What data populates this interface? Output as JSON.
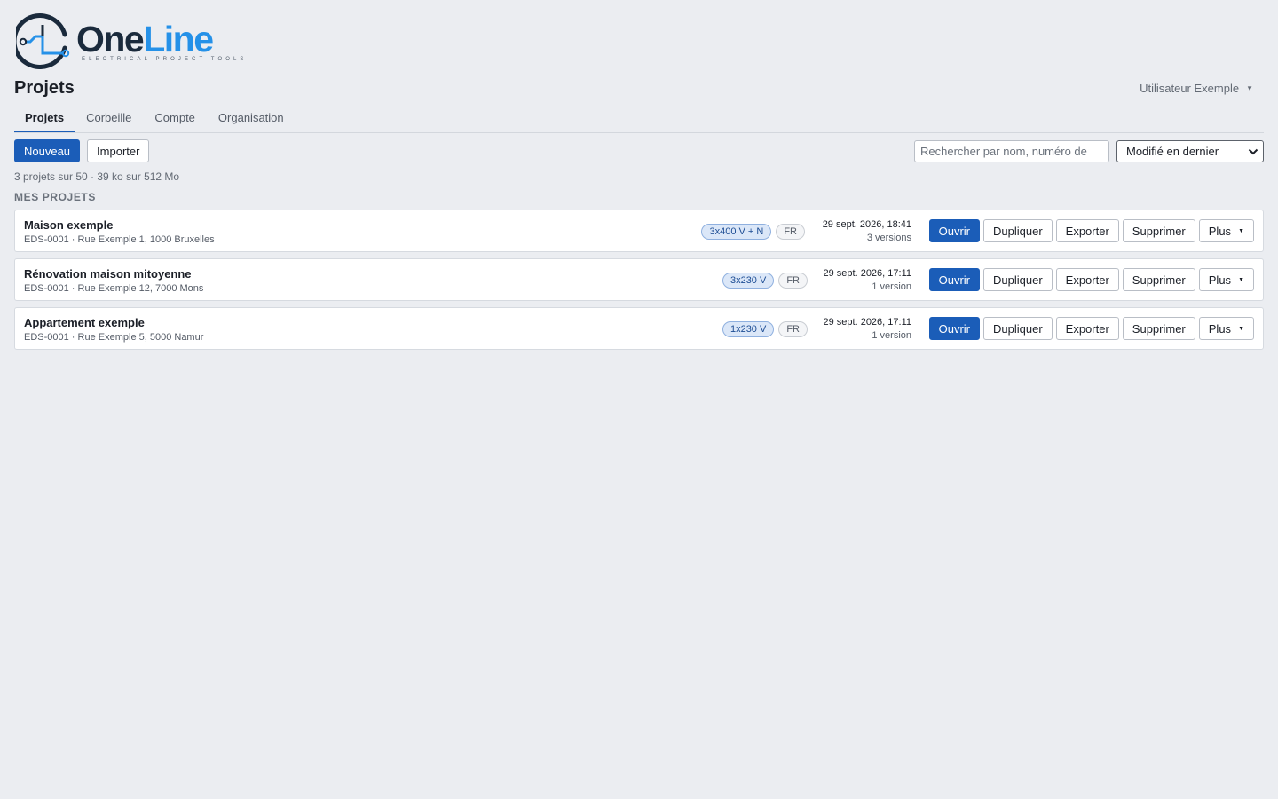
{
  "brand": {
    "name_part1": "One",
    "name_part2": "Line",
    "tagline": "ELECTRICAL PROJECT TOOLS",
    "primary_color": "#1a2a3c",
    "accent_color": "#2591e8"
  },
  "header": {
    "title": "Projets",
    "user_name": "Utilisateur Exemple"
  },
  "tabs": [
    {
      "label": "Projets",
      "active": true
    },
    {
      "label": "Corbeille",
      "active": false
    },
    {
      "label": "Compte",
      "active": false
    },
    {
      "label": "Organisation",
      "active": false
    }
  ],
  "toolbar": {
    "new_label": "Nouveau",
    "import_label": "Importer",
    "search_placeholder": "Rechercher par nom, numéro de",
    "sort_value": "Modifié en dernier"
  },
  "summary": "3 projets sur 50 · 39 ko sur 512 Mo",
  "section_title": "MES PROJETS",
  "projects": [
    {
      "name": "Maison exemple",
      "details": "EDS-0001 · Rue Exemple 1, 1000 Bruxelles",
      "voltage": "3x400 V + N",
      "language": "FR",
      "modified": "29 sept. 2026, 18:41",
      "versions": "3 versions"
    },
    {
      "name": "Rénovation maison mitoyenne",
      "details": "EDS-0001 · Rue Exemple 12, 7000 Mons",
      "voltage": "3x230 V",
      "language": "FR",
      "modified": "29 sept. 2026, 17:11",
      "versions": "1 version"
    },
    {
      "name": "Appartement exemple",
      "details": "EDS-0001 · Rue Exemple 5, 5000 Namur",
      "voltage": "1x230 V",
      "language": "FR",
      "modified": "29 sept. 2026, 17:11",
      "versions": "1 version"
    }
  ],
  "row_actions": {
    "open": "Ouvrir",
    "duplicate": "Dupliquer",
    "export": "Exporter",
    "delete": "Supprimer",
    "more": "Plus"
  },
  "colors": {
    "primary_button": "#1b5db8",
    "page_background": "#ebedf1",
    "voltage_badge_bg": "#dbe7f8"
  }
}
